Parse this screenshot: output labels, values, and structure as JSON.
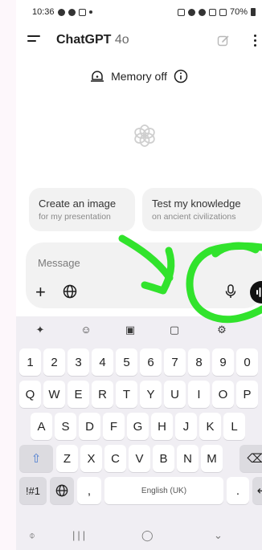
{
  "status": {
    "time": "10:36",
    "battery": "70%"
  },
  "header": {
    "title": "ChatGPT",
    "model": "4o"
  },
  "memory": {
    "label": "Memory off"
  },
  "suggestions": [
    {
      "title": "Create an image",
      "subtitle": "for my presentation"
    },
    {
      "title": "Test my knowledge",
      "subtitle": "on ancient civilizations"
    }
  ],
  "composer": {
    "placeholder": "Message"
  },
  "keyboard": {
    "row1": [
      "1",
      "2",
      "3",
      "4",
      "5",
      "6",
      "7",
      "8",
      "9",
      "0"
    ],
    "row2": [
      "Q",
      "W",
      "E",
      "R",
      "T",
      "Y",
      "U",
      "I",
      "O",
      "P"
    ],
    "row3": [
      "A",
      "S",
      "D",
      "F",
      "G",
      "H",
      "J",
      "K",
      "L"
    ],
    "row4": [
      "Z",
      "X",
      "C",
      "V",
      "B",
      "N",
      "M"
    ],
    "symbols": "!#1",
    "comma": ",",
    "space": "English (UK)",
    "period": "."
  },
  "colors": {
    "annotation": "#31e32c",
    "background": "#ffffff",
    "chip": "#f2f2f2"
  }
}
